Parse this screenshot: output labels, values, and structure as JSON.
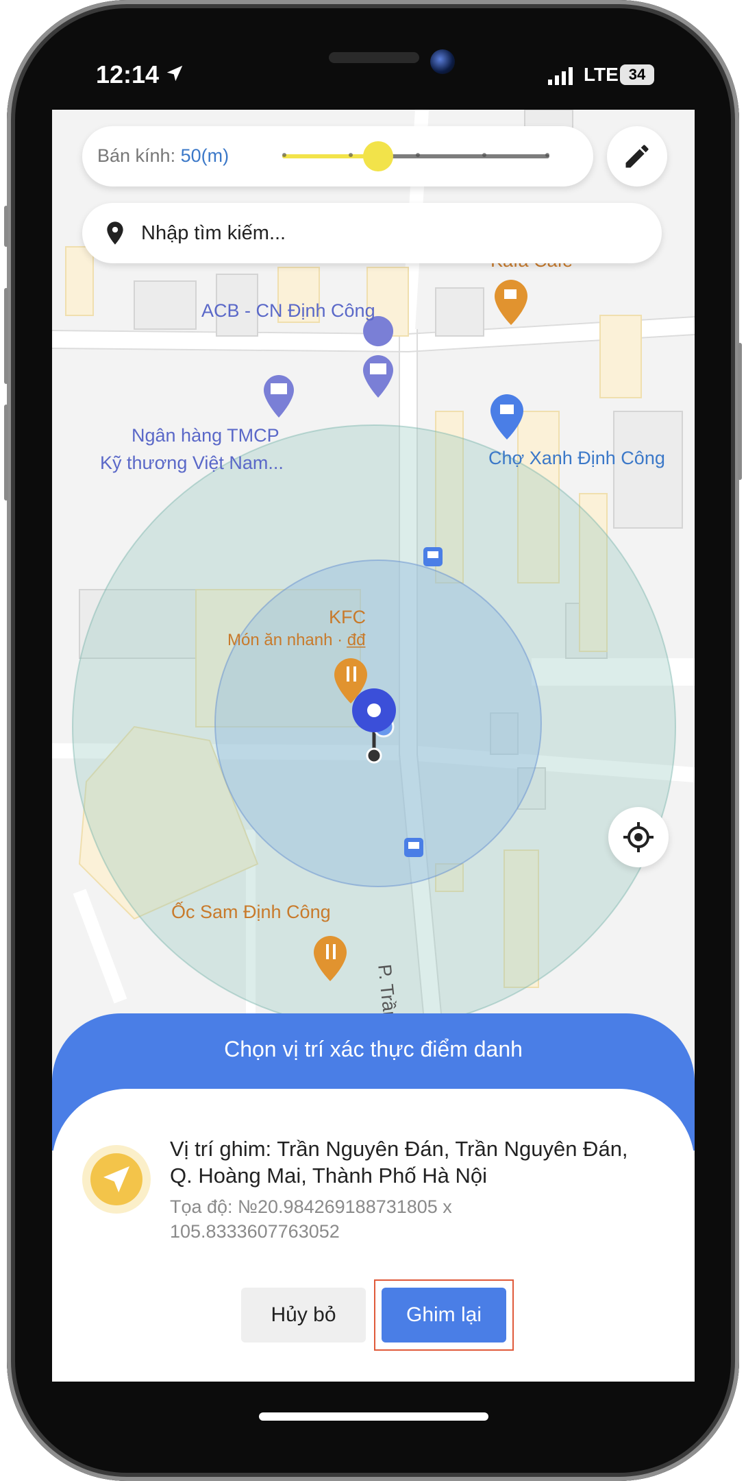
{
  "status_bar": {
    "time": "12:14",
    "network": "LTE",
    "battery": "34",
    "icons": [
      "location-arrow-icon",
      "signal-icon",
      "battery-icon"
    ]
  },
  "radius": {
    "label": "Bán kính:",
    "value": "50(m)",
    "slider_fraction": 0.36
  },
  "search": {
    "placeholder": "Nhập tìm kiếm..."
  },
  "map_labels": {
    "acb": "ACB - CN Định Công",
    "bank_line1": "Ngân hàng TMCP",
    "bank_line2": "Kỹ thương Việt Nam...",
    "market": "Chợ Xanh Định Công",
    "kfc": "KFC",
    "kfc_sub": "Món ăn nhanh · đ̲đ̲",
    "oc_sam": "Ốc Sam Định Công",
    "street": "P. Trần Nguyên Đán",
    "cafe": "Kafa Cafe"
  },
  "sheet": {
    "title": "Chọn vị trí xác thực điểm danh",
    "address": "Vị trí ghim: Trần Nguyên Đán, Trần Nguyên Đán, Q. Hoàng Mai, Thành Phố Hà Nội",
    "coords": "Tọa độ: №20.984269188731805 x 105.8333607763052",
    "cancel_label": "Hủy bỏ",
    "pin_label": "Ghim lại"
  },
  "colors": {
    "accent": "#4a7ee6",
    "slider": "#f2e34a",
    "highlight": "#e05a3a",
    "pin": "#3b4fd9"
  }
}
